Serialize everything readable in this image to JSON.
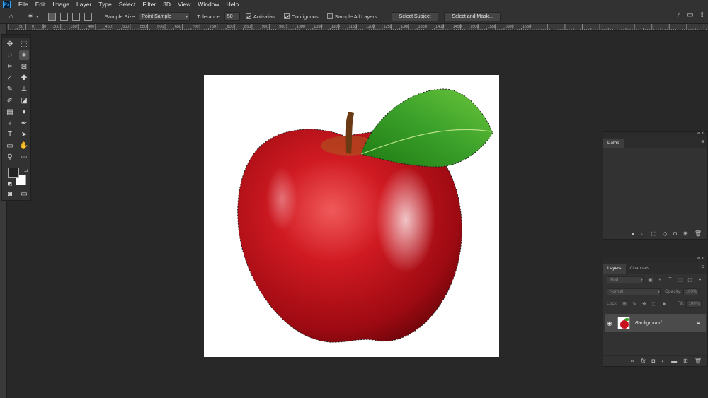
{
  "menubar": {
    "logo": "Ps",
    "items": [
      "File",
      "Edit",
      "Image",
      "Layer",
      "Type",
      "Select",
      "Filter",
      "3D",
      "View",
      "Window",
      "Help"
    ]
  },
  "options": {
    "sample_size_label": "Sample Size:",
    "sample_size_value": "Point Sample",
    "tolerance_label": "Tolerance:",
    "tolerance_value": "50",
    "anti_alias_label": "Anti-alias",
    "contiguous_label": "Contiguous",
    "sample_all_layers_label": "Sample All Layers",
    "select_subject_label": "Select Subject",
    "select_and_mask_label": "Select and Mask..."
  },
  "ruler": {
    "h_labels": [
      "300",
      "350",
      "400",
      "450",
      "500",
      "550",
      "600",
      "650",
      "700",
      "750",
      "800",
      "850",
      "900",
      "950",
      "1000",
      "1050",
      "1100",
      "1150",
      "1200",
      "1250",
      "1300",
      "1350",
      "1400",
      "1450",
      "1500",
      "1550",
      "1600",
      "1650"
    ],
    "h_prefix": [
      "50",
      "0",
      "50"
    ]
  },
  "paths_panel": {
    "tab": "Paths"
  },
  "layers_panel": {
    "tabs": [
      "Layers",
      "Channels"
    ],
    "kind_placeholder": "Kind",
    "blend_mode": "Normal",
    "opacity_label": "Opacity:",
    "opacity_value": "100%",
    "lock_label": "Lock:",
    "fill_label": "Fill:",
    "fill_value": "100%",
    "layer_name": "Background"
  },
  "colors": {
    "accent": "#31a8ff",
    "apple_red": "#c8101e",
    "leaf_green": "#3aa02a"
  }
}
